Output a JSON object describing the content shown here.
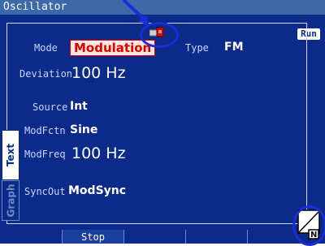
{
  "window": {
    "title": "Oscillator"
  },
  "status": {
    "run_label": "Run"
  },
  "fields": {
    "mode_label": "Mode",
    "mode_value": "Modulation",
    "type_label": "Type",
    "type_value": "FM",
    "deviation_label": "Deviation",
    "deviation_value": "100 Hz",
    "source_label": "Source",
    "source_value": "Int",
    "modfctn_label": "ModFctn",
    "modfctn_value": "Sine",
    "modfreq_label": "ModFreq",
    "modfreq_value": "100 Hz",
    "syncout_label": "SyncOut",
    "syncout_value": "ModSync"
  },
  "side_tabs": {
    "text_label": "Text",
    "graph_label": "Graph"
  },
  "softkeys": [
    "",
    "Stop",
    "",
    "",
    "",
    ""
  ],
  "corner": {
    "badge_letter": "N"
  },
  "colors": {
    "screen_bg": "#0b2a8a",
    "title_bg": "#3e69a8",
    "highlight": "#e00000",
    "annotation": "#1b2dd8"
  },
  "icons": {
    "device": "external-device-icon",
    "corner": "keyboard-status-icon",
    "pointer": "pointer-arrow-icon"
  }
}
